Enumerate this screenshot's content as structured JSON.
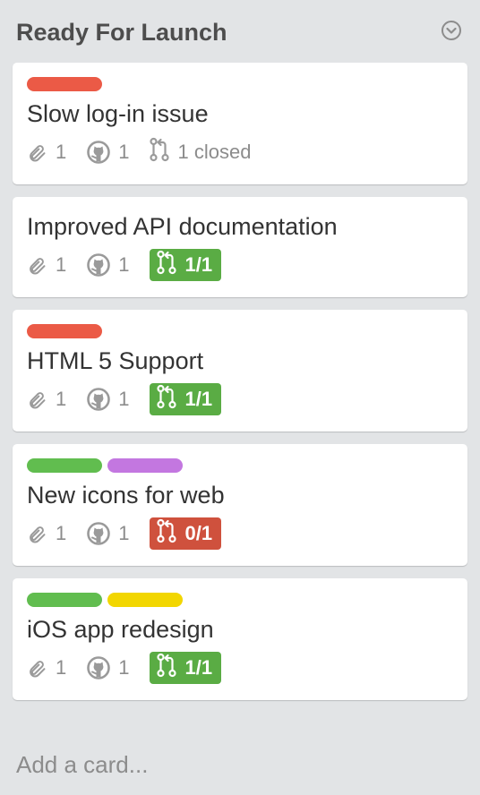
{
  "list": {
    "title": "Ready For Launch",
    "menu_icon": "chevron-down-circle-icon",
    "add_card_label": "Add a card..."
  },
  "colors": {
    "label_red": "#eb5a46",
    "label_green": "#61bd4f",
    "label_purple": "#c377e0",
    "label_yellow": "#f2d600",
    "pr_green": "#5aac44",
    "pr_red": "#cf513d"
  },
  "cards": [
    {
      "title": "Slow log-in issue",
      "labels": [
        "#eb5a46"
      ],
      "attachments": "1",
      "github": "1",
      "pr_text": "1 closed",
      "pr_style": "plain",
      "pr_color": ""
    },
    {
      "title": "Improved API documentation",
      "labels": [],
      "attachments": "1",
      "github": "1",
      "pr_text": "1/1",
      "pr_style": "pill",
      "pr_color": "#5aac44"
    },
    {
      "title": "HTML 5 Support",
      "labels": [
        "#eb5a46"
      ],
      "attachments": "1",
      "github": "1",
      "pr_text": "1/1",
      "pr_style": "pill",
      "pr_color": "#5aac44"
    },
    {
      "title": "New icons for web",
      "labels": [
        "#61bd4f",
        "#c377e0"
      ],
      "attachments": "1",
      "github": "1",
      "pr_text": "0/1",
      "pr_style": "pill",
      "pr_color": "#cf513d"
    },
    {
      "title": "iOS app redesign",
      "labels": [
        "#61bd4f",
        "#f2d600"
      ],
      "attachments": "1",
      "github": "1",
      "pr_text": "1/1",
      "pr_style": "pill",
      "pr_color": "#5aac44"
    }
  ]
}
